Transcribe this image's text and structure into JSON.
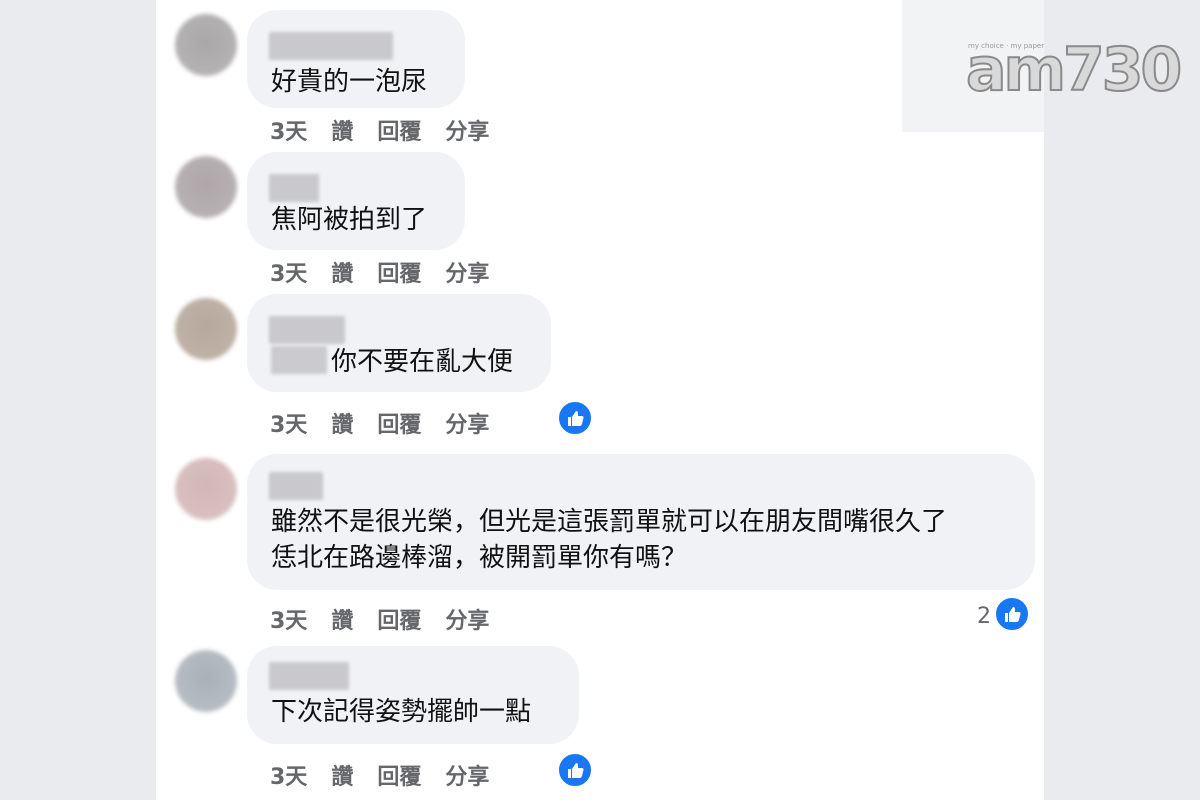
{
  "logo": {
    "brand": "am730",
    "tagline": "my choice · my paper"
  },
  "comments": [
    {
      "text": "好貴的一泡尿",
      "time": "3天",
      "like": "讚",
      "reply": "回覆",
      "share": "分享",
      "reactions": ""
    },
    {
      "text": "焦阿被拍到了",
      "time": "3天",
      "like": "讚",
      "reply": "回覆",
      "share": "分享",
      "reactions": ""
    },
    {
      "text": "你不要在亂大便",
      "time": "3天",
      "like": "讚",
      "reply": "回覆",
      "share": "分享",
      "reactions": ""
    },
    {
      "text_line1": "雖然不是很光榮，但光是這張罰單就可以在朋友間嘴很久了",
      "text_line2": "恁北在路邊棒溜，被開罰單你有嗎？",
      "time": "3天",
      "like": "讚",
      "reply": "回覆",
      "share": "分享",
      "reactions": "2"
    },
    {
      "text": "下次記得姿勢擺帥一點",
      "time": "3天",
      "like": "讚",
      "reply": "回覆",
      "share": "分享",
      "reactions": ""
    }
  ],
  "colors": {
    "like_blue": "#1877f2",
    "bubble": "#f0f2f5",
    "meta": "#65676b"
  },
  "icons": {
    "reaction": "like-thumb-icon"
  }
}
